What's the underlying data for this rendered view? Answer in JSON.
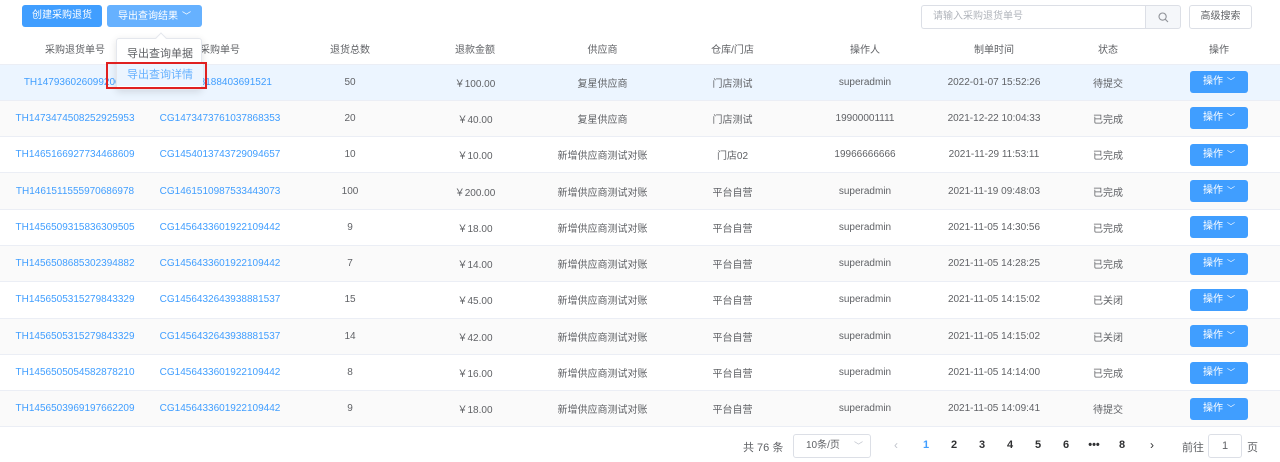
{
  "toolbar": {
    "create_label": "创建采购退货",
    "export_label": "导出查询结果",
    "search_placeholder": "请输入采购退货单号",
    "advanced_label": "高级搜索"
  },
  "dropdown": {
    "items": [
      "导出查询单据",
      "导出查询详情"
    ]
  },
  "table": {
    "headers": [
      "采购退货单号",
      "采购单号",
      "退货总数",
      "退款金额",
      "供应商",
      "仓库/门店",
      "操作人",
      "制单时间",
      "状态",
      "操作"
    ],
    "action_label": "操作",
    "rows": [
      {
        "no": "TH1479360260992069",
        "po": "CG1478188403691521",
        "qty": "50",
        "amount": "￥100.00",
        "supplier": "复星供应商",
        "store": "门店测试",
        "operator": "superadmin",
        "time": "2022-01-07 15:52:26",
        "status": "待提交"
      },
      {
        "no": "TH1473474508252925953",
        "po": "CG1473473761037868353",
        "qty": "20",
        "amount": "￥40.00",
        "supplier": "复星供应商",
        "store": "门店测试",
        "operator": "19900001111",
        "time": "2021-12-22 10:04:33",
        "status": "已完成"
      },
      {
        "no": "TH1465166927734468609",
        "po": "CG1454013743729094657",
        "qty": "10",
        "amount": "￥10.00",
        "supplier": "新增供应商测试对账",
        "store": "门店02",
        "operator": "19966666666",
        "time": "2021-11-29 11:53:11",
        "status": "已完成"
      },
      {
        "no": "TH1461511555970686978",
        "po": "CG1461510987533443073",
        "qty": "100",
        "amount": "￥200.00",
        "supplier": "新增供应商测试对账",
        "store": "平台自营",
        "operator": "superadmin",
        "time": "2021-11-19 09:48:03",
        "status": "已完成"
      },
      {
        "no": "TH1456509315836309505",
        "po": "CG1456433601922109442",
        "qty": "9",
        "amount": "￥18.00",
        "supplier": "新增供应商测试对账",
        "store": "平台自营",
        "operator": "superadmin",
        "time": "2021-11-05 14:30:56",
        "status": "已完成"
      },
      {
        "no": "TH1456508685302394882",
        "po": "CG1456433601922109442",
        "qty": "7",
        "amount": "￥14.00",
        "supplier": "新增供应商测试对账",
        "store": "平台自营",
        "operator": "superadmin",
        "time": "2021-11-05 14:28:25",
        "status": "已完成"
      },
      {
        "no": "TH1456505315279843329",
        "po": "CG1456432643938881537",
        "qty": "15",
        "amount": "￥45.00",
        "supplier": "新增供应商测试对账",
        "store": "平台自营",
        "operator": "superadmin",
        "time": "2021-11-05 14:15:02",
        "status": "已关闭"
      },
      {
        "no": "TH1456505315279843329",
        "po": "CG1456432643938881537",
        "qty": "14",
        "amount": "￥42.00",
        "supplier": "新增供应商测试对账",
        "store": "平台自营",
        "operator": "superadmin",
        "time": "2021-11-05 14:15:02",
        "status": "已关闭"
      },
      {
        "no": "TH1456505054582878210",
        "po": "CG1456433601922109442",
        "qty": "8",
        "amount": "￥16.00",
        "supplier": "新增供应商测试对账",
        "store": "平台自营",
        "operator": "superadmin",
        "time": "2021-11-05 14:14:00",
        "status": "已完成"
      },
      {
        "no": "TH1456503969197662209",
        "po": "CG1456433601922109442",
        "qty": "9",
        "amount": "￥18.00",
        "supplier": "新增供应商测试对账",
        "store": "平台自营",
        "operator": "superadmin",
        "time": "2021-11-05 14:09:41",
        "status": "待提交"
      }
    ]
  },
  "pagination": {
    "total": "共 76 条",
    "page_size": "10条/页",
    "pages": [
      "1",
      "2",
      "3",
      "4",
      "5",
      "6",
      "•••",
      "8"
    ],
    "current": "1",
    "goto_label": "前往",
    "goto_value": "1",
    "unit_label": "页"
  },
  "colors": {
    "primary": "#409eff",
    "highlight_row": "#ecf5ff",
    "annotation_red": "#e02020"
  }
}
